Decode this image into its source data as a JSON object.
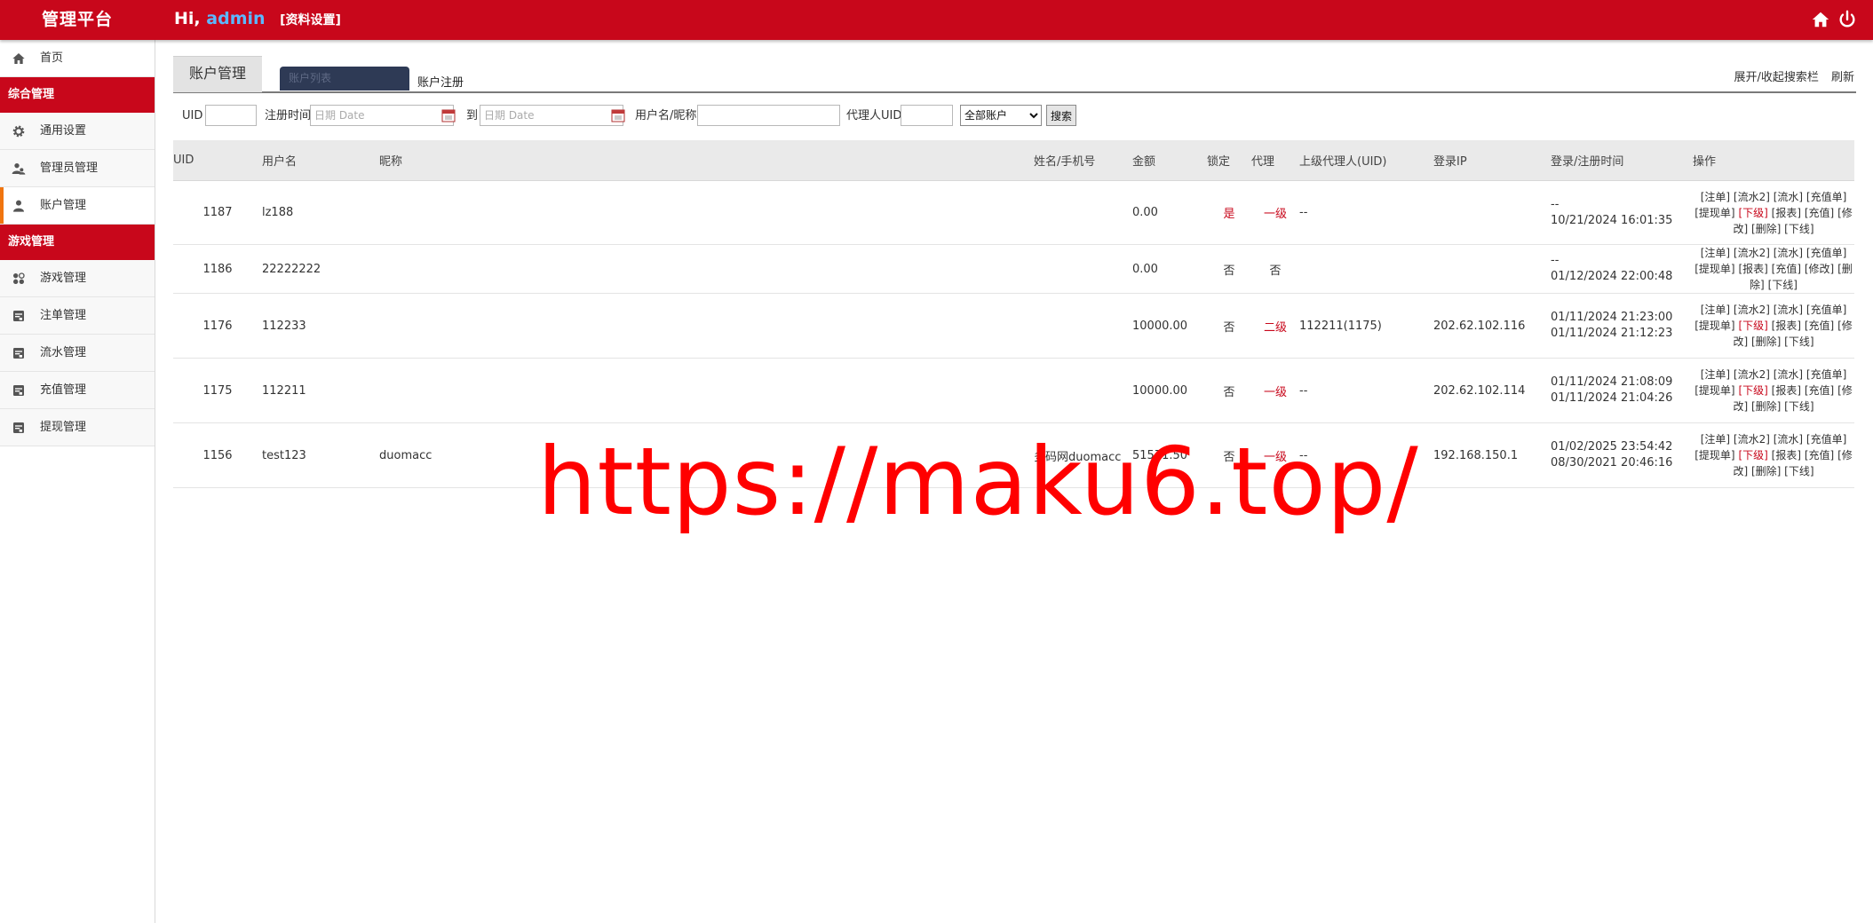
{
  "header": {
    "brand": "管理平台",
    "greeting_prefix": "Hi,",
    "username": "admin",
    "profile_link": "[资料设置]",
    "icons": [
      "home-icon",
      "power-icon"
    ]
  },
  "sidebar": {
    "home": "首页",
    "section1": "综合管理",
    "general_settings": "通用设置",
    "admin_mgmt": "管理员管理",
    "account_mgmt": "账户管理",
    "section2": "游戏管理",
    "game_mgmt": "游戏管理",
    "bet_mgmt": "注单管理",
    "flow_mgmt": "流水管理",
    "recharge_mgmt": "充值管理",
    "withdraw_mgmt": "提现管理"
  },
  "tabs": {
    "main": "账户管理",
    "list": "账户列表",
    "register": "账户注册",
    "toggle_search": "展开/收起搜索栏",
    "refresh": "刷新"
  },
  "filters": {
    "uid_label": "UID",
    "reg_time_label": "注册时间",
    "date_placeholder": "日期 Date",
    "to_label": "到",
    "username_label": "用户名/昵称",
    "agent_uid_label": "代理人UID",
    "account_type_selected": "全部账户",
    "search_button": "搜索"
  },
  "table": {
    "headers": {
      "uid": "UID",
      "username": "用户名",
      "nickname": "昵称",
      "name_phone": "姓名/手机号",
      "balance": "金额",
      "locked": "锁定",
      "agent": "代理",
      "parent_agent": "上级代理人(UID)",
      "login_ip": "登录IP",
      "login_reg_time": "登录/注册时间",
      "actions": "操作"
    },
    "ops": {
      "bets": "[注单]",
      "flow2": "[流水2]",
      "flow": "[流水]",
      "recharge_order": "[充值单]",
      "withdraw_order": "[提现单]",
      "subordinate": "[下级]",
      "report": "[报表]",
      "recharge": "[充值]",
      "edit": "[修改]",
      "delete": "[删除]",
      "offline": "[下线]"
    },
    "rows": [
      {
        "uid": "1187",
        "username": "lz188",
        "nickname": "",
        "name_phone": "",
        "balance": "0.00",
        "locked": "是",
        "agent": "一级",
        "parent": "--",
        "ip": "",
        "login_time": "--",
        "reg_time": "10/21/2024 16:01:35"
      },
      {
        "uid": "1186",
        "username": "22222222",
        "nickname": "",
        "name_phone": "",
        "balance": "0.00",
        "locked": "否",
        "agent": "否",
        "parent": "",
        "ip": "",
        "login_time": "--",
        "reg_time": "01/12/2024 22:00:48"
      },
      {
        "uid": "1176",
        "username": "112233",
        "nickname": "",
        "name_phone": "",
        "balance": "10000.00",
        "locked": "否",
        "agent": "二级",
        "parent": "112211(1175)",
        "ip": "202.62.102.116",
        "login_time": "01/11/2024 21:23:00",
        "reg_time": "01/11/2024 21:12:23"
      },
      {
        "uid": "1175",
        "username": "112211",
        "nickname": "",
        "name_phone": "",
        "balance": "10000.00",
        "locked": "否",
        "agent": "一级",
        "parent": "--",
        "ip": "202.62.102.114",
        "login_time": "01/11/2024 21:08:09",
        "reg_time": "01/11/2024 21:04:26"
      },
      {
        "uid": "1156",
        "username": "test123",
        "nickname": "duomacc",
        "name_phone": "多码网duomacc",
        "balance": "51571.50",
        "locked": "否",
        "agent": "一级",
        "parent": "--",
        "ip": "192.168.150.1",
        "login_time": "01/02/2025 23:54:42",
        "reg_time": "08/30/2021 20:46:16"
      }
    ]
  },
  "watermark": "https://maku6.top/",
  "colors": {
    "brand_red": "#c8071b",
    "active_orange": "#f0750f",
    "tab_dark": "#2e3a55",
    "username_blue": "#5bb8ff"
  }
}
